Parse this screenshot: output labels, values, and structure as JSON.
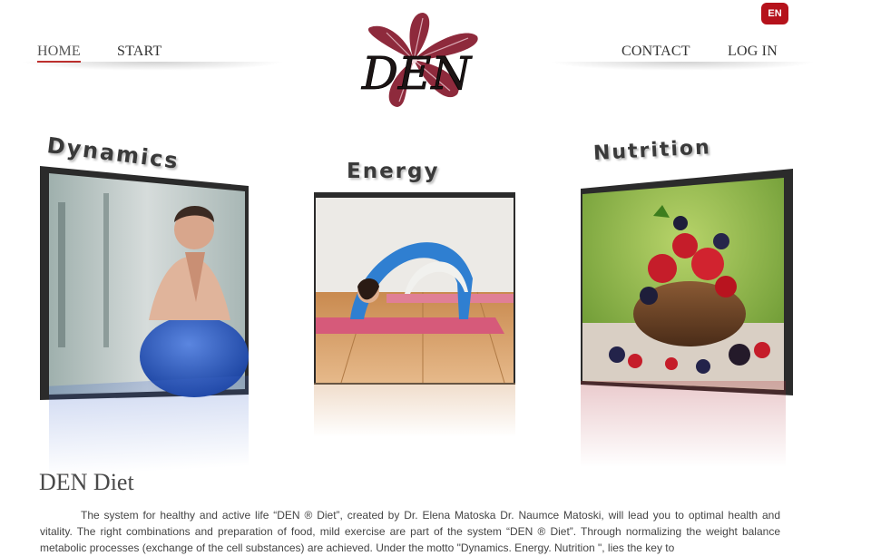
{
  "language": {
    "label": "EN"
  },
  "nav": {
    "left": [
      {
        "label": "HOME"
      },
      {
        "label": "START"
      }
    ],
    "right": [
      {
        "label": "CONTACT"
      },
      {
        "label": "LOG IN"
      }
    ]
  },
  "logo": {
    "text": "DEN"
  },
  "tiles": [
    {
      "title": "Dynamics",
      "image": "woman-exercise-ball-photo"
    },
    {
      "title": "Energy",
      "image": "yoga-backbend-photo"
    },
    {
      "title": "Nutrition",
      "image": "berries-bowl-photo"
    }
  ],
  "content": {
    "title": "DEN Diet",
    "body": "The system for healthy and active life “DEN ® Diet”, created by Dr. Elena Matoska Dr. Naumce Matoski, will lead you to optimal health and vitality. The right combinations and preparation of food, mild exercise are part of the system “DEN ® Diet”. Through normalizing the weight balance metabolic processes (exchange of the cell substances) are achieved. Under the motto \"Dynamics. Energy. Nutrition \", lies the key to"
  },
  "colors": {
    "accent": "#b5121b",
    "text": "#4a4a4a",
    "frame": "#2b2b2b"
  }
}
